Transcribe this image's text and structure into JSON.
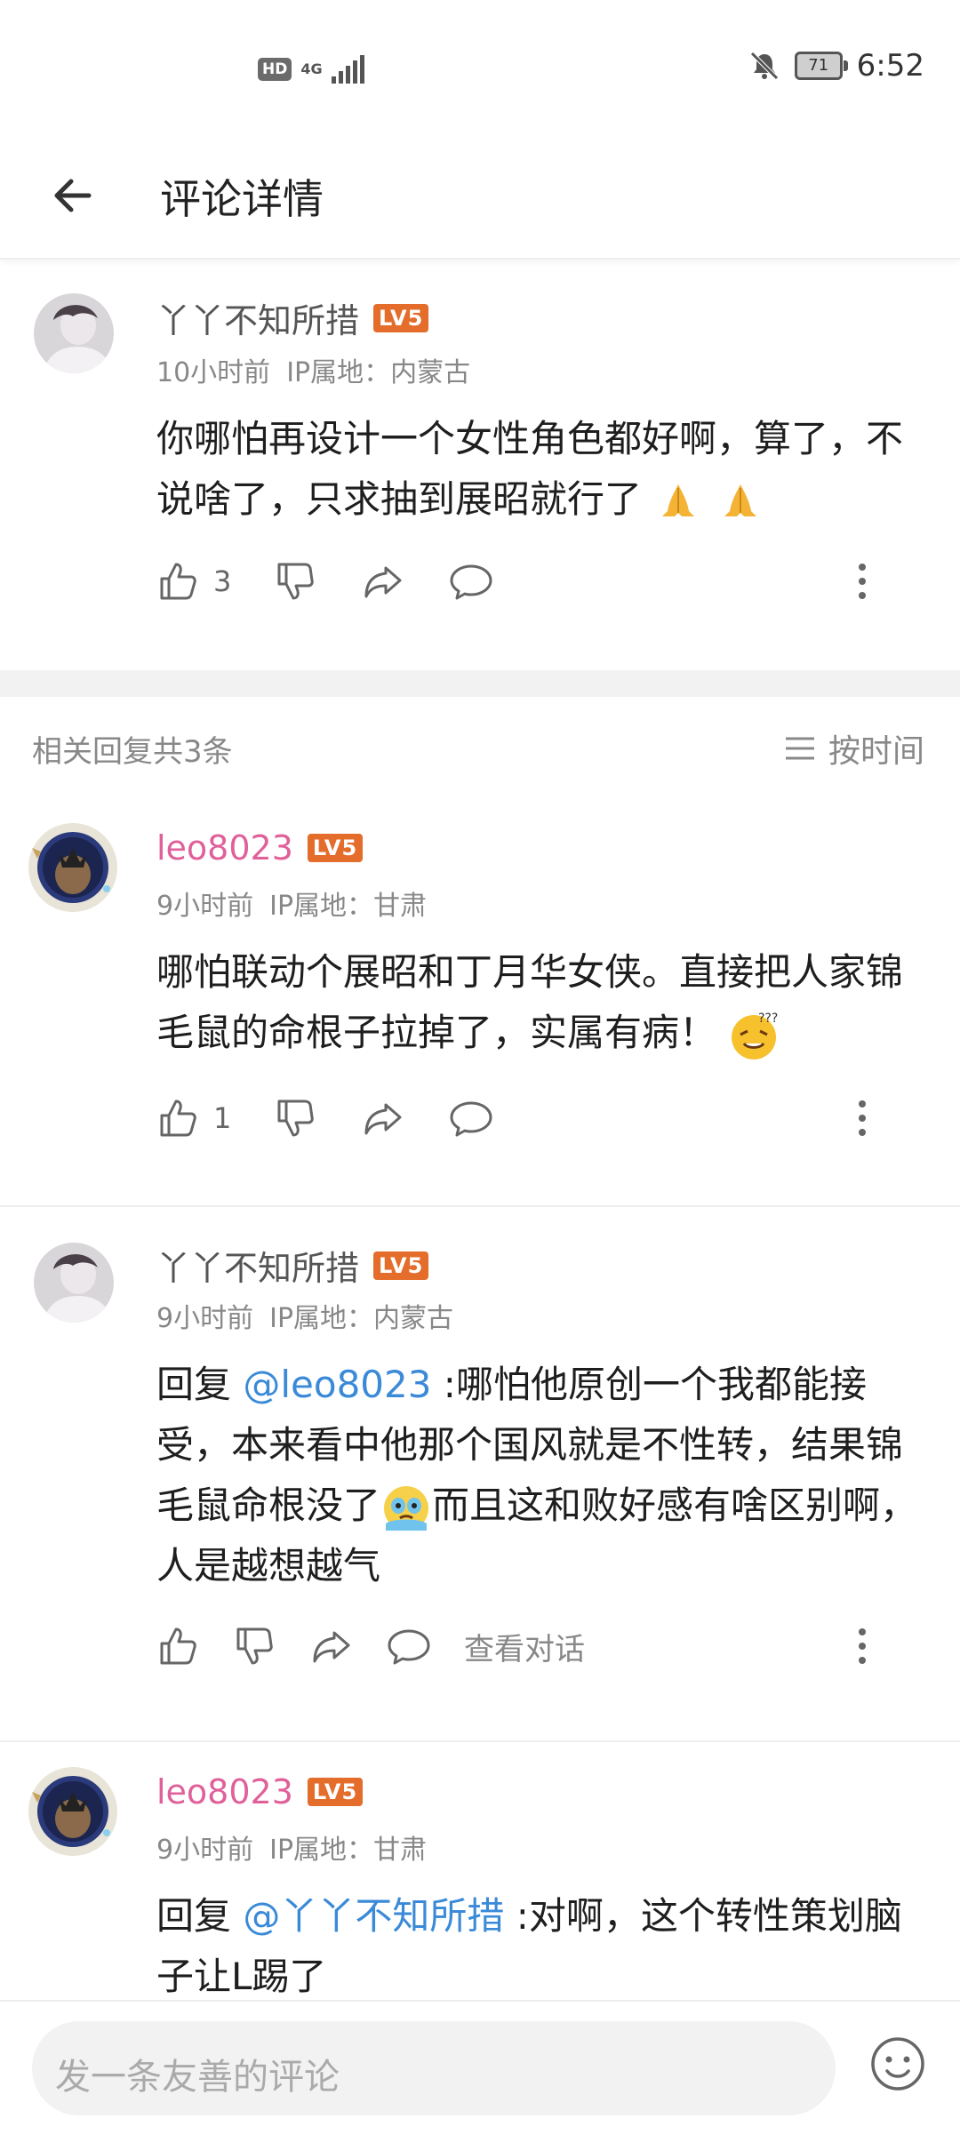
{
  "status_bar": {
    "hd": "HD",
    "network": "4G",
    "battery": "71",
    "time": "6:52"
  },
  "header": {
    "title": "评论详情"
  },
  "main_comment": {
    "user": "丫丫不知所措",
    "level": "LV5",
    "time": "10小时前",
    "ip": "IP属地：内蒙古",
    "text": "你哪怕再设计一个女性角色都好啊，算了，不说啥了，只求抽到展昭就行了",
    "likes": "3"
  },
  "replies_header": {
    "count": "相关回复共3条",
    "sort": "按时间"
  },
  "replies": [
    {
      "user": "leo8023",
      "level": "LV5",
      "time": "9小时前",
      "ip": "IP属地：甘肃",
      "text": "哪怕联动个展昭和丁月华女侠。直接把人家锦毛鼠的命根子拉掉了，实属有病！",
      "likes": "1"
    },
    {
      "user": "丫丫不知所措",
      "level": "LV5",
      "time": "9小时前",
      "ip": "IP属地：内蒙古",
      "reply_prefix": "回复 ",
      "mention": "@leo8023",
      "text_part1": " :哪怕他原创一个我都能接受，本来看中他那个国风就是不性转，结果锦毛鼠命根没了",
      "text_part2": "而且这和败好感有啥区别啊，人是越想越气",
      "view_conversation": "查看对话"
    },
    {
      "user": "leo8023",
      "level": "LV5",
      "time": "9小时前",
      "ip": "IP属地：甘肃",
      "reply_prefix": "回复 ",
      "mention": "@丫丫不知所措",
      "text_part1": " :对啊，这个转性策划脑子让L踢了"
    }
  ],
  "bottom_bar": {
    "placeholder": "发一条友善的评论"
  },
  "colors": {
    "pink_user": "#e0619a",
    "mention": "#3a8ad8",
    "level_badge": "#e46d2b"
  }
}
